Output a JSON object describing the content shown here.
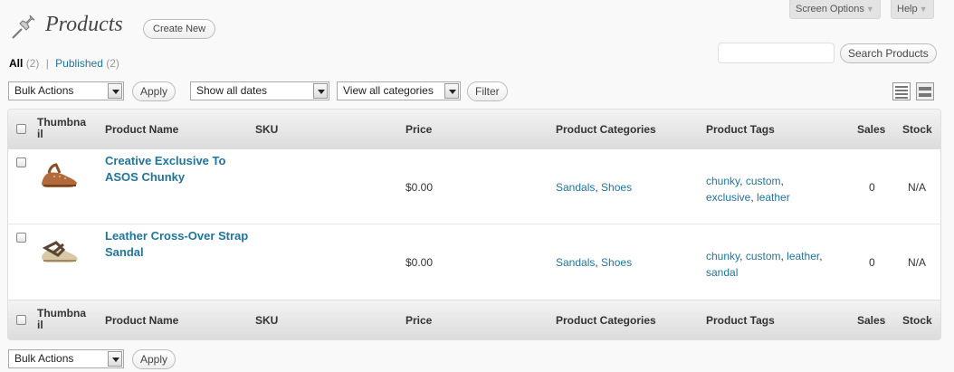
{
  "header": {
    "screen_options": "Screen Options",
    "help": "Help",
    "title": "Products",
    "create_new": "Create New"
  },
  "filters": {
    "all": "All",
    "all_count": "(2)",
    "separator": "|",
    "published": "Published",
    "published_count": "(2)"
  },
  "search": {
    "value": "",
    "button": "Search Products"
  },
  "toolbar": {
    "bulk_actions": "Bulk Actions",
    "apply": "Apply",
    "dates": "Show all dates",
    "categories": "View all categories",
    "filter": "Filter"
  },
  "table": {
    "columns": {
      "thumbnail": "Thumbna\nil",
      "name": "Product Name",
      "sku": "SKU",
      "price": "Price",
      "categories": "Product Categories",
      "tags": "Product Tags",
      "sales": "Sales",
      "stock": "Stock"
    },
    "rows": [
      {
        "name": "Creative Exclusive To ASOS Chunky",
        "sku": "",
        "price": "$0.00",
        "categories": [
          "Sandals",
          "Shoes"
        ],
        "tags": [
          "chunky",
          "custom",
          "exclusive",
          "leather"
        ],
        "sales": "0",
        "stock": "N/A"
      },
      {
        "name": "Leather Cross-Over Strap Sandal",
        "sku": "",
        "price": "$0.00",
        "categories": [
          "Sandals",
          "Shoes"
        ],
        "tags": [
          "chunky",
          "custom",
          "leather",
          "sandal"
        ],
        "sales": "0",
        "stock": "N/A"
      }
    ]
  },
  "bottom_toolbar": {
    "bulk_actions": "Bulk Actions",
    "apply": "Apply"
  },
  "icons": {
    "page": "pushpin-icon",
    "list_view": "list-view-icon",
    "excerpt_view": "excerpt-view-icon"
  },
  "colors": {
    "link": "#21759b",
    "header_bg": "#dcdcdc"
  }
}
